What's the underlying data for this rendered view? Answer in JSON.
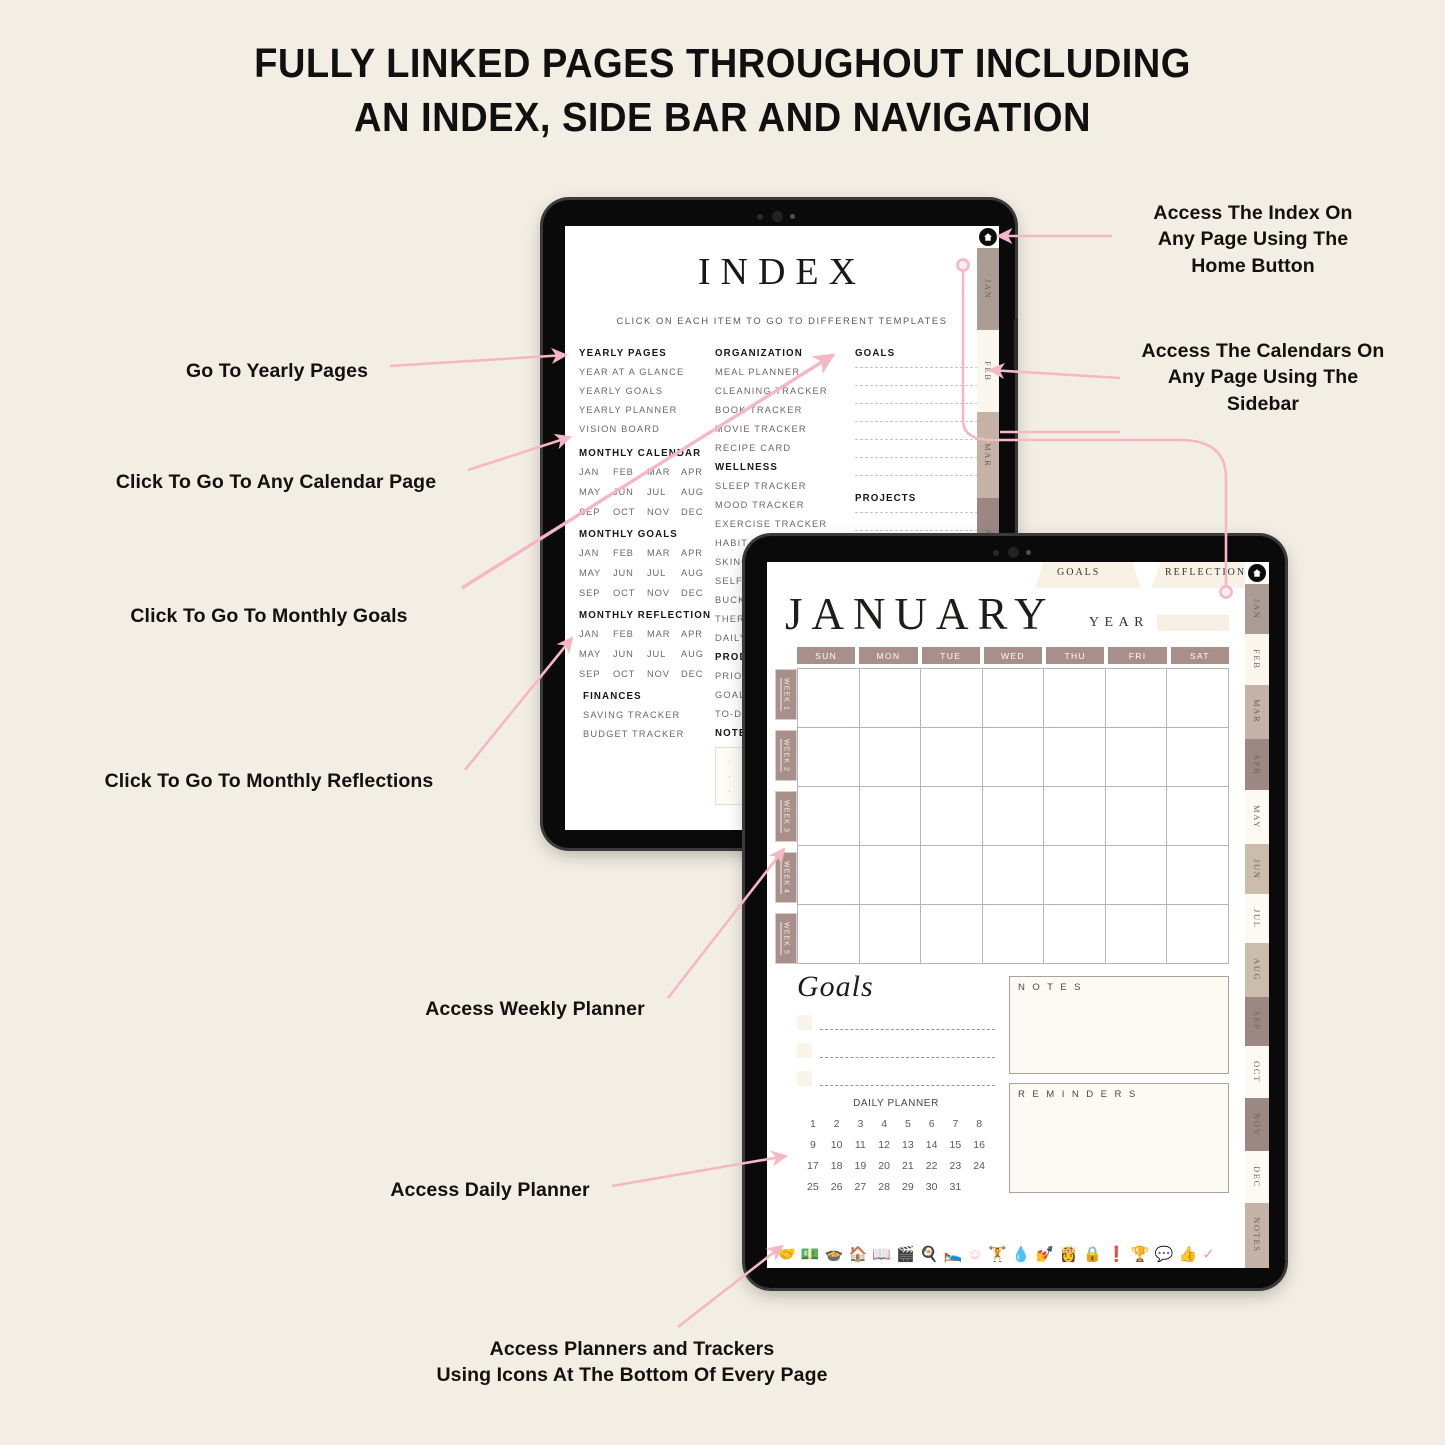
{
  "headline": {
    "line1": "FULLY LINKED PAGES THROUGHOUT INCLUDING",
    "line2": "AN INDEX, SIDE BAR AND NAVIGATION"
  },
  "annotations": [
    {
      "id": "yearly-pages",
      "text": "Go To Yearly Pages"
    },
    {
      "id": "calendar-page",
      "text": "Click To Go To Any Calendar Page"
    },
    {
      "id": "monthly-goals",
      "text": "Click To Go To Monthly Goals"
    },
    {
      "id": "monthly-reflect",
      "text": "Click To Go To Monthly Reflections"
    },
    {
      "id": "weekly-planner",
      "text": "Access Weekly Planner"
    },
    {
      "id": "daily-planner",
      "text": "Access Daily Planner"
    },
    {
      "id": "home-button",
      "line1": "Access The Index On",
      "line2": "Any Page Using The",
      "line3": "Home Button"
    },
    {
      "id": "sidebar",
      "line1": "Access The Calendars On",
      "line2": "Any Page Using The",
      "line3": "Sidebar"
    },
    {
      "id": "bottom-icons",
      "line1": "Access Planners and Trackers",
      "line2": "Using Icons At The Bottom Of Every Page"
    }
  ],
  "index_page": {
    "title": "INDEX",
    "subtitle": "CLICK ON EACH ITEM TO GO TO DIFFERENT TEMPLATES",
    "column_a": {
      "yearly_heading": "YEARLY PAGES",
      "yearly_items": [
        "YEAR AT A GLANCE",
        "YEARLY GOALS",
        "YEARLY PLANNER",
        "VISION BOARD"
      ],
      "monthly_calendar_heading": "MONTHLY CALENDAR",
      "monthly_goals_heading": "MONTHLY GOALS",
      "monthly_reflection_heading": "MONTHLY REFLECTION",
      "months": [
        "JAN",
        "FEB",
        "MAR",
        "APR",
        "MAY",
        "JUN",
        "JUL",
        "AUG",
        "SEP",
        "OCT",
        "NOV",
        "DEC"
      ],
      "finances_heading": "FINANCES",
      "finances_items": [
        "SAVING TRACKER",
        "BUDGET TRACKER"
      ]
    },
    "column_b": {
      "organization_heading": "ORGANIZATION",
      "organization_items": [
        "MEAL PLANNER",
        "CLEANING TRACKER",
        "BOOK TRACKER",
        "MOVIE TRACKER",
        "RECIPE CARD"
      ],
      "wellness_heading": "WELLNESS",
      "wellness_items": [
        "SLEEP TRACKER",
        "MOOD TRACKER",
        "EXERCISE TRACKER",
        "HABIT TRACKER",
        "SKINCARE",
        "SELF CARE",
        "BUCKET LIST",
        "THERAPY",
        "DAILY"
      ],
      "productivity_heading": "PRODUCTIVITY",
      "productivity_items": [
        "PRIORITIES",
        "GOAL",
        "TO-DO"
      ],
      "notes_heading": "NOTES"
    },
    "column_c": {
      "goals_heading": "GOALS",
      "goals_lines": 7,
      "projects_heading": "PROJECTS",
      "projects_lines": 2
    }
  },
  "january_page": {
    "top_tabs": [
      "GOALS",
      "REFLECTION"
    ],
    "month_title": "JANUARY",
    "year_label": "YEAR",
    "year_value": "",
    "day_headers": [
      "SUN",
      "MON",
      "TUE",
      "WED",
      "THU",
      "FRI",
      "SAT"
    ],
    "week_tabs": [
      "WEEK 1",
      "WEEK 2",
      "WEEK 3",
      "WEEK 4",
      "WEEK 5"
    ],
    "goals_label": "Goals",
    "goals_rows": 3,
    "daily_planner_label": "DAILY PLANNER",
    "daily_numbers": [
      1,
      2,
      3,
      4,
      5,
      6,
      7,
      8,
      9,
      10,
      11,
      12,
      13,
      14,
      15,
      16,
      17,
      18,
      19,
      20,
      21,
      22,
      23,
      24,
      25,
      26,
      27,
      28,
      29,
      30,
      31
    ],
    "notes_label": "N O T E S",
    "reminders_label": "R E M I N D E R S",
    "bottom_icons": [
      "hand-coin-icon",
      "money-icon",
      "bowl-icon",
      "house-icon",
      "book-icon",
      "clapperboard-icon",
      "chef-hat-icon",
      "bed-icon",
      "smiley-icon",
      "dumbbell-icon",
      "water-drop-icon",
      "nail-polish-icon",
      "face-mask-icon",
      "lock-icon",
      "exclamation-icon",
      "trophy-icon",
      "speech-bubble-icon",
      "thumbs-up-icon",
      "check-icon"
    ]
  },
  "sidebar": {
    "home_icon": "home-icon",
    "months": [
      "JAN",
      "FEB",
      "MAR",
      "APR",
      "MAY",
      "JUN",
      "JUL",
      "AUG",
      "SEP",
      "OCT",
      "NOV",
      "DEC"
    ],
    "notes_tab": "NOTES"
  },
  "colors": {
    "page_background": "#f2eee3",
    "accent_pink": "#f6b7c5",
    "tab_mauve": "#a98f89",
    "tab_light": "#fbf7ef",
    "tab_tan": "#cbbdb1",
    "device_black": "#0b0a0a"
  }
}
